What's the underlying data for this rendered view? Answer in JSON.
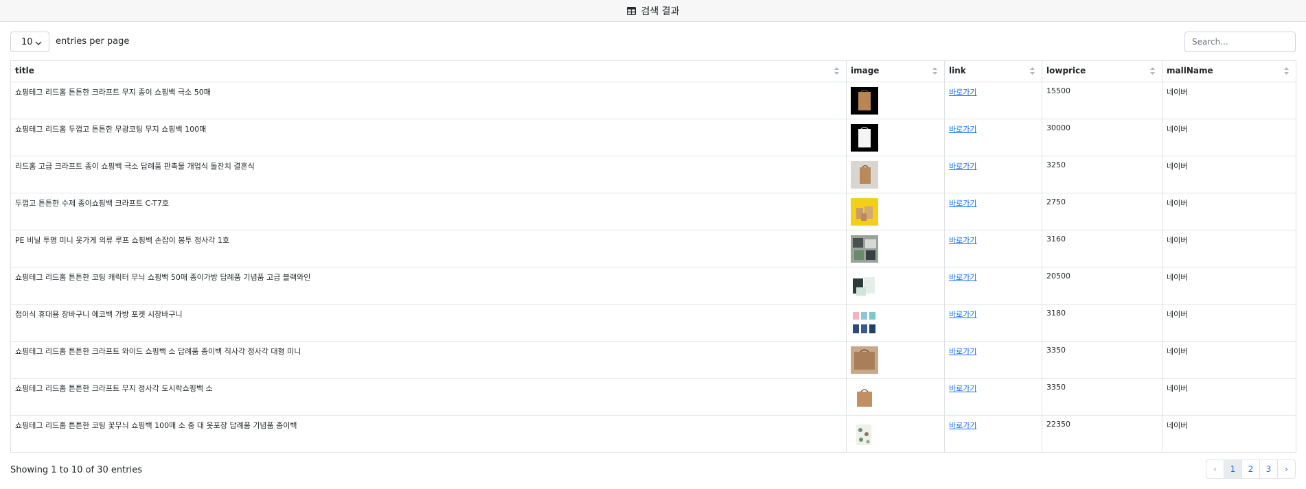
{
  "header": {
    "title": "검색 결과",
    "icon": "table-icon"
  },
  "length_menu": {
    "selected": "10",
    "label": "entries per page"
  },
  "search": {
    "placeholder": "Search..."
  },
  "table": {
    "columns": [
      "title",
      "image",
      "link",
      "lowprice",
      "mallName"
    ],
    "rows": [
      {
        "title": "쇼핑테그 리드홈 튼튼한 크라프트 무지 종이 쇼핑백 극소 50매",
        "image": "kraft-bag-image",
        "link": "바로가기",
        "lowprice": "15500",
        "mallName": "네이버"
      },
      {
        "title": "쇼핑테그 리드홈 두껍고 튼튼한 무광코팅 무지 쇼핑백 100매",
        "image": "white-bag-image",
        "link": "바로가기",
        "lowprice": "30000",
        "mallName": "네이버"
      },
      {
        "title": "리드홈 고급 크라프트 종이 쇼핑백 극소 답례품 판촉물 개업식 돌잔치 결혼식",
        "image": "kraft-bag-gray-image",
        "link": "바로가기",
        "lowprice": "3250",
        "mallName": "네이버"
      },
      {
        "title": "두껍고 튼튼한 수제 종이쇼핑백 크라프트 C-T7호",
        "image": "yellow-bags-image",
        "link": "바로가기",
        "lowprice": "2750",
        "mallName": "네이버"
      },
      {
        "title": "PE 비닐 투명 미니 옷가게 의류 루프 쇼핑백 손잡이 봉투 정사각 1호",
        "image": "vinyl-bags-image",
        "link": "바로가기",
        "lowprice": "3160",
        "mallName": "네이버"
      },
      {
        "title": "쇼핑테그 리드홈 튼튼한 코팅 캐릭터 무늬 쇼핑백 50매 종이가방 답례품 기념품 고급 블랙와인",
        "image": "pattern-bags-image",
        "link": "바로가기",
        "lowprice": "20500",
        "mallName": "네이버"
      },
      {
        "title": "접이식 휴대용 장바구니 에코백 가방 포켓 시장바구니",
        "image": "eco-bags-image",
        "link": "바로가기",
        "lowprice": "3180",
        "mallName": "네이버"
      },
      {
        "title": "쇼핑테그 리드홈 튼튼한 크라프트 와이드 쇼핑백 소 답례품 종이백 직사각 정사각 대형 미니",
        "image": "wide-kraft-bag-image",
        "link": "바로가기",
        "lowprice": "3350",
        "mallName": "네이버"
      },
      {
        "title": "쇼핑테그 리드홈 튼튼한 크라프트 무지 정사각 도시락쇼핑백 소",
        "image": "square-kraft-bag-image",
        "link": "바로가기",
        "lowprice": "3350",
        "mallName": "네이버"
      },
      {
        "title": "쇼핑테그 리드홈 튼튼한 코팅 꽃무늬 쇼핑백 100매 소 중 대 옷포장 답례품 기념품 종이백",
        "image": "floral-bag-image",
        "link": "바로가기",
        "lowprice": "22350",
        "mallName": "네이버"
      }
    ]
  },
  "footer": {
    "info": "Showing 1 to 10 of 30 entries",
    "pagination": {
      "prev": "‹",
      "pages": [
        "1",
        "2",
        "3"
      ],
      "next": "›",
      "active": "1"
    }
  }
}
